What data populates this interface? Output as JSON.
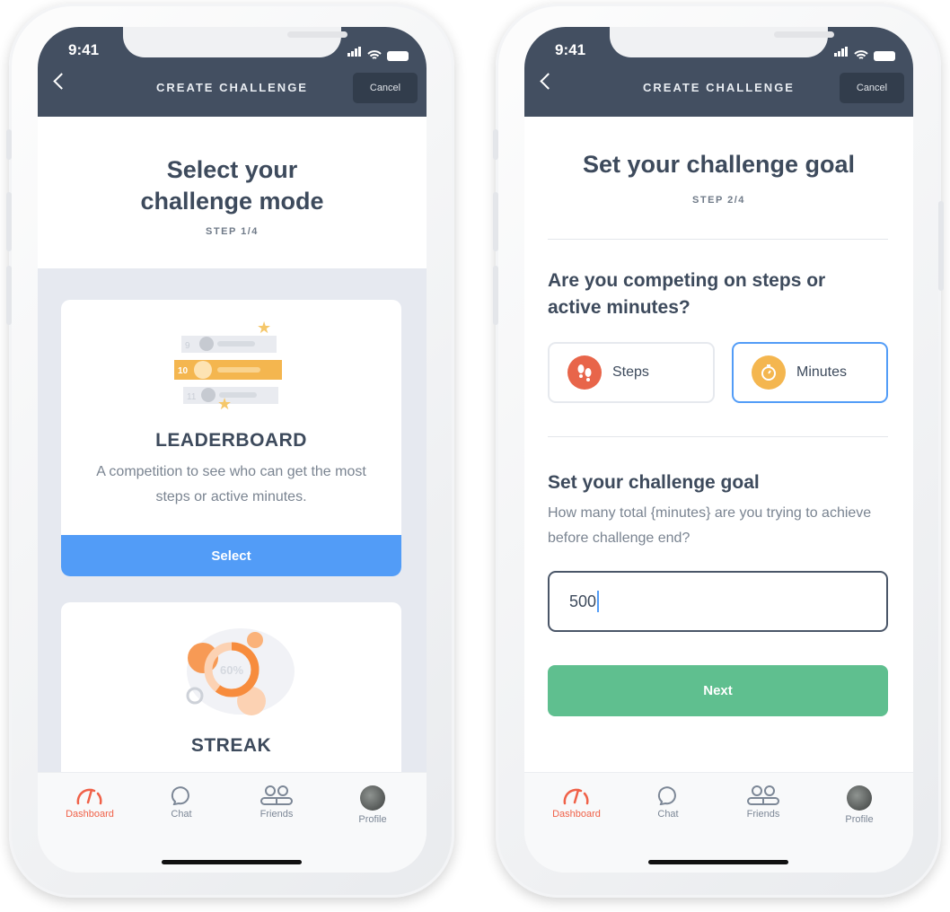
{
  "status": {
    "time": "9:41"
  },
  "header": {
    "title": "CREATE CHALLENGE",
    "cancel_label": "Cancel"
  },
  "tabs": [
    {
      "label": "Dashboard",
      "icon": "gauge-icon",
      "active": true
    },
    {
      "label": "Chat",
      "icon": "chat-bubble-icon"
    },
    {
      "label": "Friends",
      "icon": "friends-icon"
    },
    {
      "label": "Profile",
      "icon": "avatar"
    }
  ],
  "screen1": {
    "title_line1": "Select your",
    "title_line2": "challenge mode",
    "step": "STEP 1/4",
    "cards": [
      {
        "title": "LEADERBOARD",
        "description": "A competition to see who can get the most steps or active minutes.",
        "select_label": "Select",
        "illustration": {
          "ranks": [
            "9",
            "10",
            "11"
          ]
        }
      },
      {
        "title": "STREAK",
        "illustration": {
          "percent": "60%"
        }
      }
    ]
  },
  "screen2": {
    "title": "Set your challenge goal",
    "step": "STEP 2/4",
    "question": "Are you competing on steps or active minutes?",
    "options": [
      {
        "label": "Steps",
        "icon": "footsteps-icon",
        "color": "#e8654a",
        "selected": false
      },
      {
        "label": "Minutes",
        "icon": "stopwatch-icon",
        "color": "#f4b64f",
        "selected": true
      }
    ],
    "goal_heading": "Set your challenge goal",
    "goal_description": "How many total {minutes} are you trying to achieve before challenge end?",
    "goal_value": "500",
    "next_label": "Next"
  },
  "colors": {
    "header": "#434f61",
    "accent_blue": "#529cf7",
    "next_green": "#5fbf8f",
    "active_tab": "#f06148"
  }
}
